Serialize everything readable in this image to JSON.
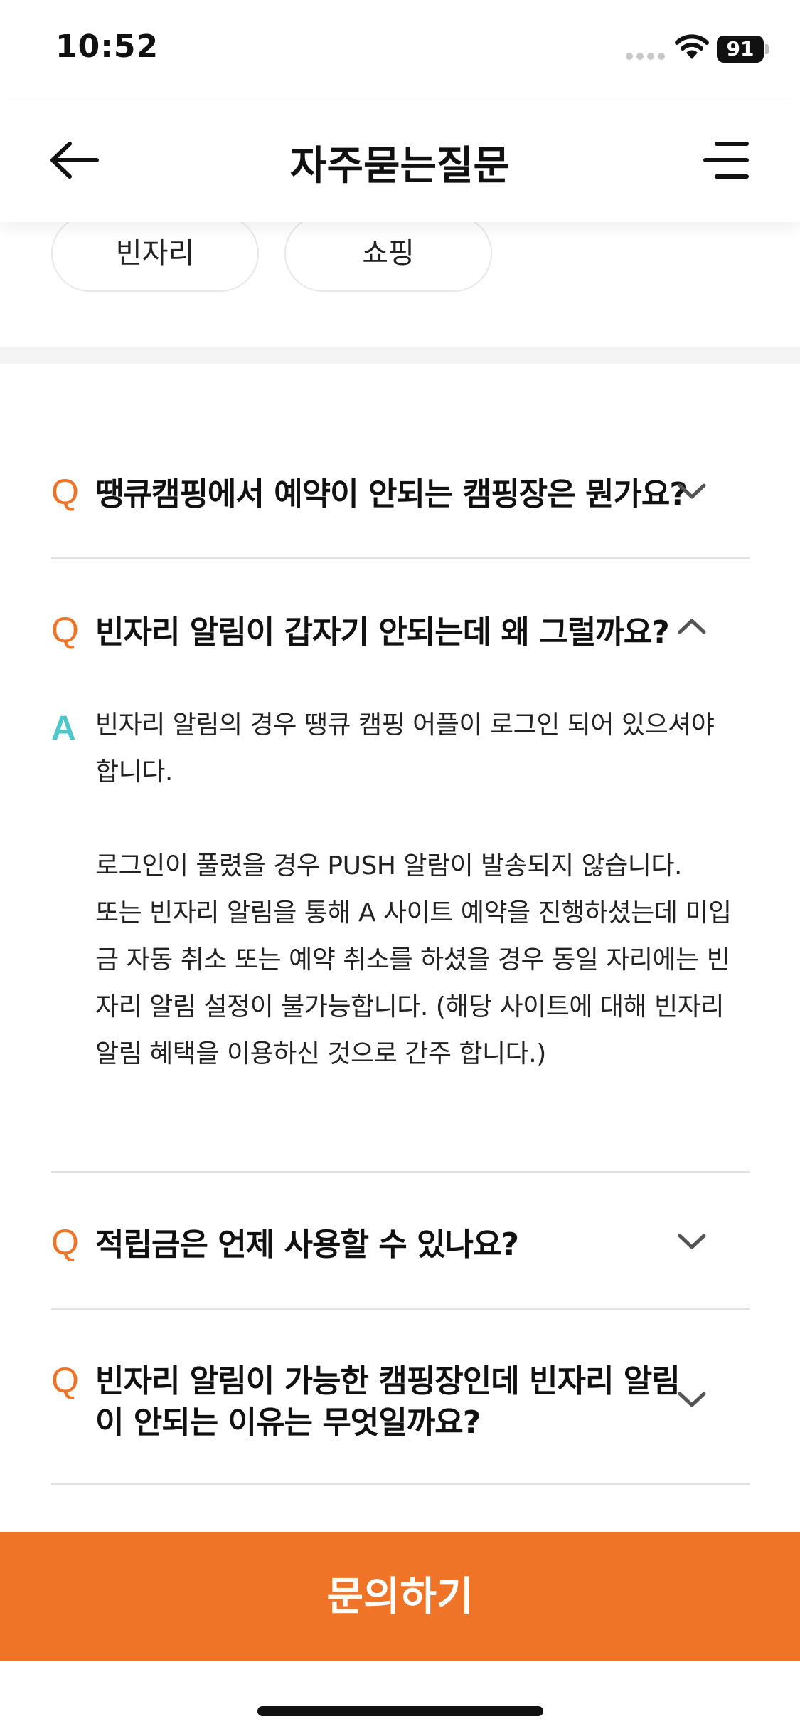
{
  "status_bar": {
    "time": "10:52",
    "battery": "91",
    "icons": [
      "signal-icon",
      "wifi-icon",
      "battery-icon"
    ]
  },
  "header": {
    "title": "자주묻는질문",
    "back_icon": "back-arrow-icon",
    "menu_icon": "menu-icon"
  },
  "categories": [
    "빈자리",
    "쇼핑"
  ],
  "faq": {
    "q_mark": "Q",
    "a_mark": "A",
    "items": [
      {
        "question": "땡큐캠핑에서 예약이 안되는 캠핑장은 뭔가요?",
        "expanded": false
      },
      {
        "question": "빈자리 알림이 갑자기 안되는데 왜 그럴까요?",
        "expanded": true,
        "answer_lines": [
          "빈자리 알림의 경우 땡큐 캠핑 어플이 로그인 되어 있으셔야",
          "합니다.",
          "",
          "로그인이 풀렸을 경우 PUSH 알람이 발송되지 않습니다.",
          "또는 빈자리 알림을 통해 A 사이트 예약을 진행하셨는데 미입",
          "금 자동 취소 또는 예약 취소를 하셨을 경우 동일 자리에는 빈",
          "자리 알림 설정이 불가능합니다. (해당 사이트에 대해 빈자리",
          "알림 혜택을 이용하신 것으로 간주 합니다.)"
        ]
      },
      {
        "question": "적립금은 언제 사용할 수 있나요?",
        "expanded": false
      },
      {
        "question_lines": [
          "빈자리 알림이 가능한 캠핑장인데 빈자리 알림",
          "이 안되는 이유는 무엇일까요?"
        ],
        "expanded": false
      }
    ]
  },
  "footer": {
    "inquiry_label": "문의하기"
  },
  "colors": {
    "accent": "#f07427",
    "answer_mark": "#4fc6cc",
    "divider": "#e2e2e2"
  }
}
